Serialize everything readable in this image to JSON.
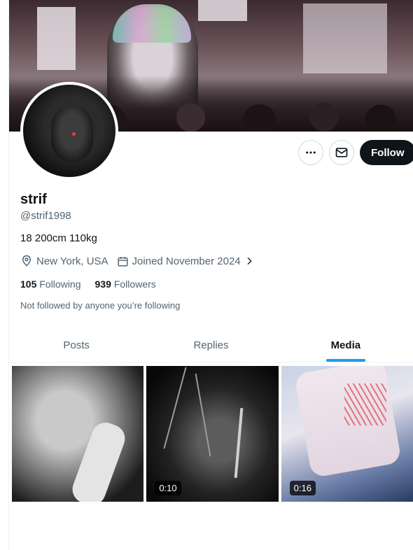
{
  "profile": {
    "name": "strif",
    "handle": "@strif1998",
    "bio": "18 200cm 110kg",
    "location": "New York, USA",
    "joined": "Joined November 2024",
    "following_count": "105",
    "following_label": "Following",
    "followers_count": "939",
    "followers_label": "Followers",
    "not_followed_note": "Not followed by anyone you’re following"
  },
  "actions": {
    "more_icon": "more-horizontal-icon",
    "message_icon": "envelope-icon",
    "follow_label": "Follow"
  },
  "tabs": [
    {
      "label": "Posts",
      "active": false
    },
    {
      "label": "Replies",
      "active": false
    },
    {
      "label": "Media",
      "active": true
    }
  ],
  "media": [
    {
      "duration": ""
    },
    {
      "duration": "0:10"
    },
    {
      "duration": "0:16"
    }
  ],
  "colors": {
    "accent": "#1d9bf0",
    "text": "#0f1419",
    "secondary_text": "#536471",
    "border": "#eff3f4"
  }
}
